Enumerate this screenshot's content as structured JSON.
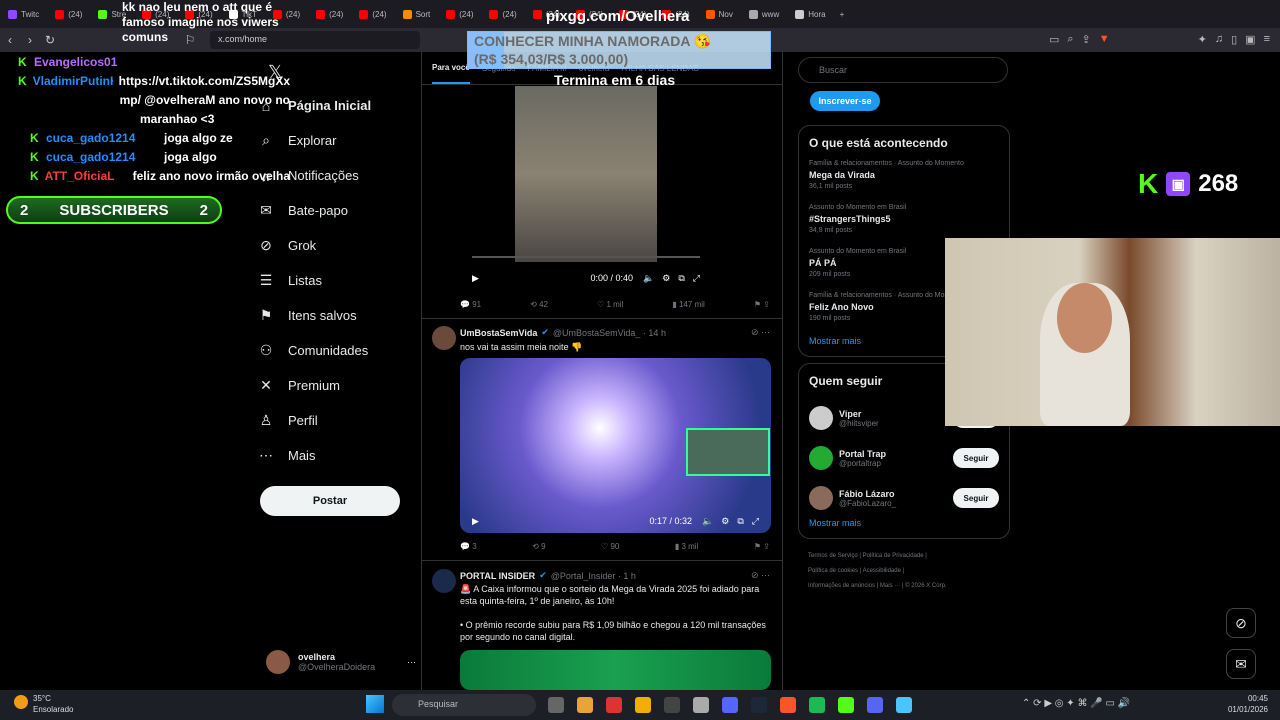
{
  "tabs": [
    {
      "label": "Twitc",
      "color": "#9146ff"
    },
    {
      "label": "(24)",
      "color": "#ff0000"
    },
    {
      "label": "Stre",
      "color": "#53fc18"
    },
    {
      "label": "(24)",
      "color": "#ff0000"
    },
    {
      "label": "(24)",
      "color": "#ff0000"
    },
    {
      "label": "TikT",
      "color": "#ffffff"
    },
    {
      "label": "(24)",
      "color": "#ff0000"
    },
    {
      "label": "(24)",
      "color": "#ff0000"
    },
    {
      "label": "(24)",
      "color": "#ff0000"
    },
    {
      "label": "Sort",
      "color": "#ff8800"
    },
    {
      "label": "(24)",
      "color": "#ff0000"
    },
    {
      "label": "(24)",
      "color": "#ff0000"
    },
    {
      "label": "(24)",
      "color": "#ff0000"
    },
    {
      "label": "(24)",
      "color": "#ff0000"
    },
    {
      "label": "(24)",
      "color": "#ff0000"
    },
    {
      "label": "(24)",
      "color": "#ff0000"
    },
    {
      "label": "Nov",
      "color": "#ff5500"
    },
    {
      "label": "www",
      "color": "#aaaaaa"
    },
    {
      "label": "Hora",
      "color": "#cccccc"
    }
  ],
  "url": "x.com/home",
  "chat": [
    {
      "user": "Evangelicos01",
      "color": "#b66dff",
      "msg": ""
    },
    {
      "user": "VladimirPutinK...",
      "color": "#1e90ff",
      "msg": "https://vt.tiktok.com/ZS5MgXx"
    },
    {
      "user": "",
      "color": "#ffffff",
      "msg": "mp/ @ovelheraM ano novo no"
    },
    {
      "user": "",
      "color": "#ffffff",
      "msg": "maranhao <3"
    },
    {
      "user": "cuca_gado1214",
      "color": "#1e90ff",
      "msg": "joga algo ze"
    },
    {
      "user": "cuca_gado1214",
      "color": "#1e90ff",
      "msg": "joga algo"
    },
    {
      "user": "ATT_OficiaL",
      "color": "#ff3b3b",
      "msg": "feliz ano novo irmão ovelha"
    }
  ],
  "chat_top": [
    "kk nao leu nem o att que é",
    "famoso imagine nos viwers",
    "comuns"
  ],
  "subs": {
    "left": "2",
    "label": "SUBSCRIBERS",
    "right": "2"
  },
  "nav": [
    {
      "label": "Página Inicial",
      "icon": "home-icon",
      "glyph": "⌂"
    },
    {
      "label": "Explorar",
      "icon": "search-icon",
      "glyph": "⌕"
    },
    {
      "label": "Notificações",
      "icon": "bell-icon",
      "glyph": "♫"
    },
    {
      "label": "Bate-papo",
      "icon": "mail-icon",
      "glyph": "✉"
    },
    {
      "label": "Grok",
      "icon": "grok-icon",
      "glyph": "⊘"
    },
    {
      "label": "Listas",
      "icon": "list-icon",
      "glyph": "☰"
    },
    {
      "label": "Itens salvos",
      "icon": "bookmark-icon",
      "glyph": "⚑"
    },
    {
      "label": "Comunidades",
      "icon": "community-icon",
      "glyph": "⚇"
    },
    {
      "label": "Premium",
      "icon": "x-icon",
      "glyph": "✕"
    },
    {
      "label": "Perfil",
      "icon": "person-icon",
      "glyph": "♙"
    },
    {
      "label": "Mais",
      "icon": "more-icon",
      "glyph": "⋯"
    }
  ],
  "post_label": "Postar",
  "profile": {
    "name": "ovelhera",
    "handle": "@OvelheraDoidera"
  },
  "feed_tabs": [
    "Para você",
    "Seguindo",
    "FAMÍLIA M",
    "ovelhera",
    "A ILHA DAS LENDAS"
  ],
  "tweet1": {
    "time": "0:00 / 0:40",
    "replies": "91",
    "rt": "42",
    "likes": "1 mil",
    "views": "147 mil"
  },
  "tweet2": {
    "name": "UmBostaSemVida",
    "handle": "@UmBostaSemVida_ · 14 h",
    "text": "nos vai ta assim meia noite 👎",
    "time": "0:17 / 0:32",
    "replies": "3",
    "rt": "9",
    "likes": "90",
    "views": "3 mil"
  },
  "tweet3": {
    "name": "PORTAL INSIDER",
    "handle": "@Portal_Insider · 1 h",
    "text1": "🚨 A Caixa informou que o sorteio da Mega da Virada 2025 foi adiado para esta quinta-feira, 1º de janeiro, às 10h!",
    "text2": "• O prêmio recorde subiu para R$ 1,09 bilhão e chegou a 120 mil transações por segundo no canal digital."
  },
  "right": {
    "search": "Buscar",
    "subscribe": "Inscrever-se",
    "trending_title": "O que está acontecendo",
    "trends": [
      {
        "cat": "Família & relacionamentos · Assunto do Momento",
        "title": "Mega da Virada",
        "count": "36,1 mil posts"
      },
      {
        "cat": "Assunto do Momento em Brasil",
        "title": "#StrangersThings5",
        "count": "34,8 mil posts"
      },
      {
        "cat": "Assunto do Momento em Brasil",
        "title": "PÁ PÁ",
        "count": "209 mil posts"
      },
      {
        "cat": "Família & relacionamentos · Assunto do Momento",
        "title": "Feliz Ano Novo",
        "count": "190 mil posts"
      }
    ],
    "show_more": "Mostrar mais",
    "who_title": "Quem seguir",
    "who": [
      {
        "name": "Viper",
        "handle": "@hiitsviper",
        "color": "#cccccc"
      },
      {
        "name": "Portal Trap",
        "handle": "@portaltrap",
        "color": "#22aa33"
      },
      {
        "name": "Fábio Lázaro",
        "handle": "@FabioLazaro_",
        "color": "#8a6a5a"
      }
    ],
    "follow": "Seguir",
    "footer1": "Termos de Serviço | Política de Privacidade |",
    "footer2": "Política de cookies | Acessibilidade |",
    "footer3": "Informações de anúncios | Mais ··· | © 2026 X Corp."
  },
  "promo": {
    "url": "pixgg.com/Ovelhera",
    "line1": "CONHECER MINHA NAMORADA 😘",
    "line2": "(R$ 354,03/R$ 3.000,00)",
    "ends": "Termina em 6 dias",
    "progress": 0.118
  },
  "kick_count": "268",
  "taskbar": {
    "temp": "35°C",
    "weather": "Ensolarado",
    "search": "Pesquisar",
    "time": "00:45",
    "date": "01/01/2026"
  }
}
